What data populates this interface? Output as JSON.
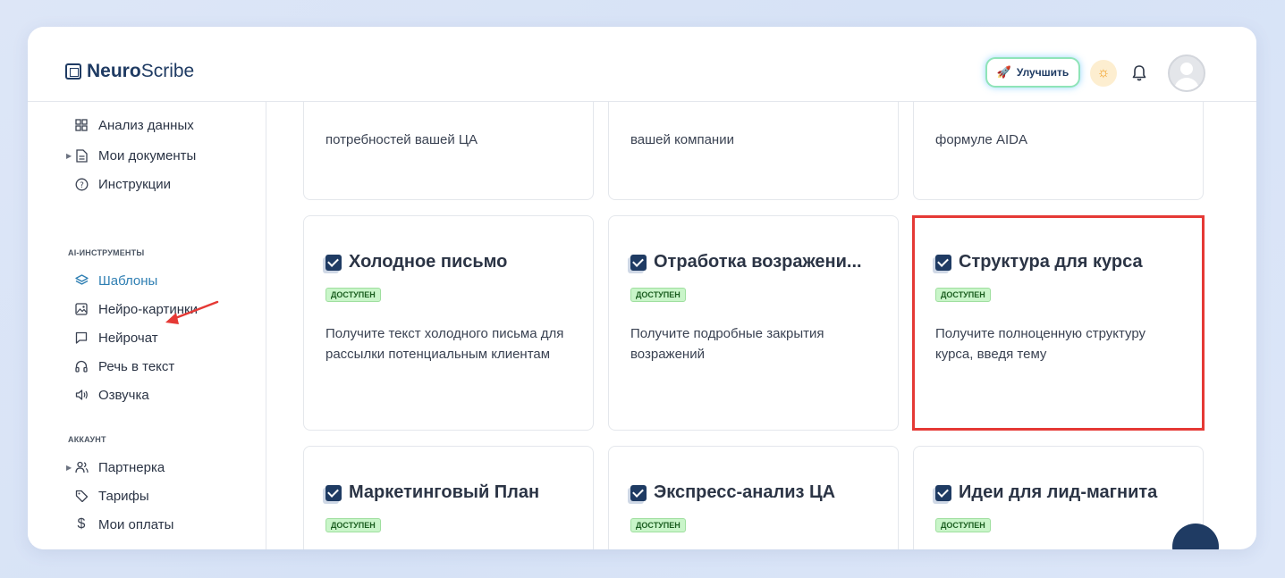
{
  "app": {
    "logo_bold": "Neuro",
    "logo_rest": "Scribe"
  },
  "topbar": {
    "upgrade_label": "Улучшить"
  },
  "sidebar": {
    "items_top": [
      {
        "label": "Анализ данных",
        "icon": "grid-icon"
      },
      {
        "label": "Мои документы",
        "icon": "document-icon"
      },
      {
        "label": "Инструкции",
        "icon": "help-circle-icon"
      }
    ],
    "section_ai": "AI-ИНСТРУМЕНТЫ",
    "items_ai": [
      {
        "label": "Шаблоны",
        "icon": "layers-icon"
      },
      {
        "label": "Нейро-картинки",
        "icon": "image-icon"
      },
      {
        "label": "Нейрочат",
        "icon": "chat-icon"
      },
      {
        "label": "Речь в текст",
        "icon": "headphones-icon"
      },
      {
        "label": "Озвучка",
        "icon": "speaker-icon"
      }
    ],
    "section_account": "АККАУНТ",
    "items_account": [
      {
        "label": "Партнерка",
        "icon": "users-icon"
      },
      {
        "label": "Тарифы",
        "icon": "tag-icon"
      },
      {
        "label": "Мои оплаты",
        "icon": "dollar-icon"
      }
    ]
  },
  "cards_top": [
    {
      "desc": "потребностей вашей ЦА"
    },
    {
      "desc": "вашей компании"
    },
    {
      "desc": "формуле AIDA"
    }
  ],
  "cards_mid": [
    {
      "title": "Холодное письмо",
      "badge": "ДОСТУПЕН",
      "desc": "Получите текст холодного письма для рассылки потенциальным клиентам"
    },
    {
      "title": "Отработка возражени...",
      "badge": "ДОСТУПЕН",
      "desc": "Получите подробные закрытия возражений"
    },
    {
      "title": "Структура для курса",
      "badge": "ДОСТУПЕН",
      "desc": "Получите полноценную структуру курса, введя тему"
    }
  ],
  "cards_bottom": [
    {
      "title": "Маркетинговый План",
      "badge": "ДОСТУПЕН"
    },
    {
      "title": "Экспресс-анализ ЦА",
      "badge": "ДОСТУПЕН"
    },
    {
      "title": "Идеи для лид-магнита",
      "badge": "ДОСТУПЕН"
    }
  ],
  "colors": {
    "accent": "#2f7fb3",
    "brand": "#1f3b63",
    "badge_bg": "#c9f5c9",
    "highlight": "#e53935"
  }
}
